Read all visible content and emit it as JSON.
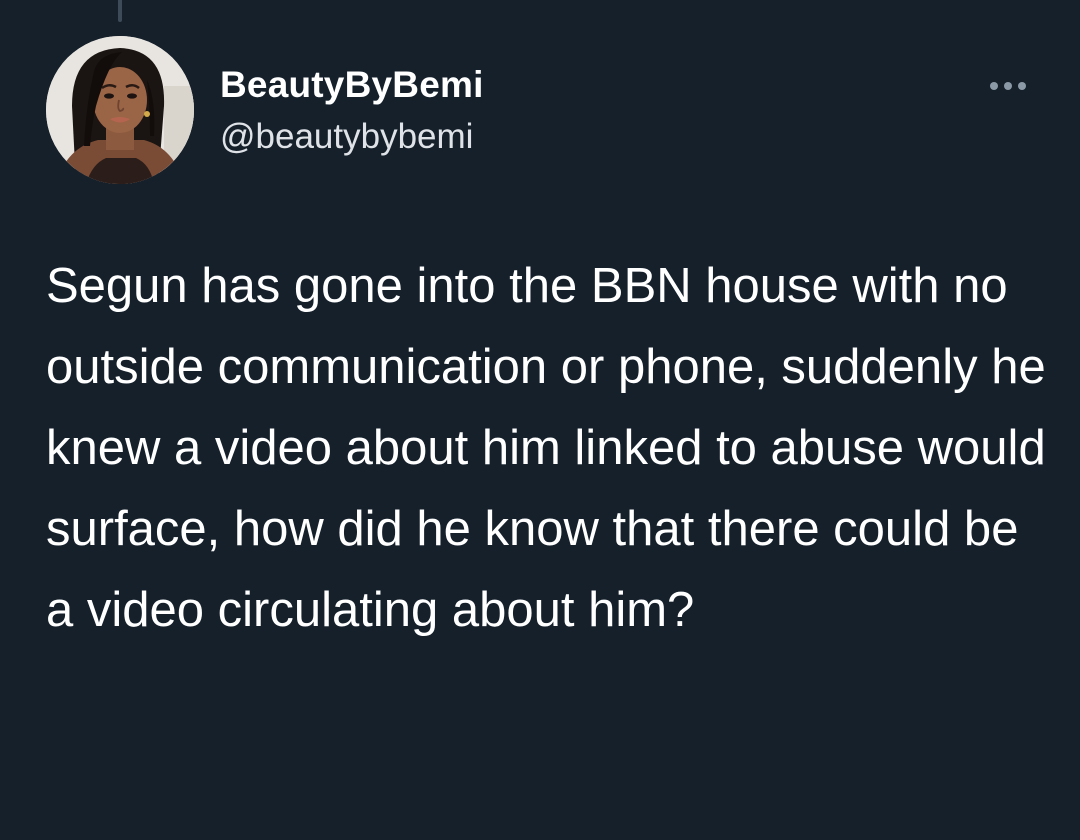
{
  "tweet": {
    "author": {
      "display_name": "BeautyByBemi",
      "handle": "@beautybybemi",
      "avatar_icon": "profile-photo"
    },
    "more_icon": "more-options-icon",
    "text": "Segun has gone into the BBN house with no outside communication or phone, suddenly he knew a video about him linked to abuse would surface, how did he know that there could be a video circulating about him?"
  },
  "colors": {
    "background": "#15202b",
    "primary_text": "#ffffff",
    "secondary_text": "#dfe3e7",
    "icon": "#8b98a5",
    "thread_line": "#3d4b59"
  }
}
